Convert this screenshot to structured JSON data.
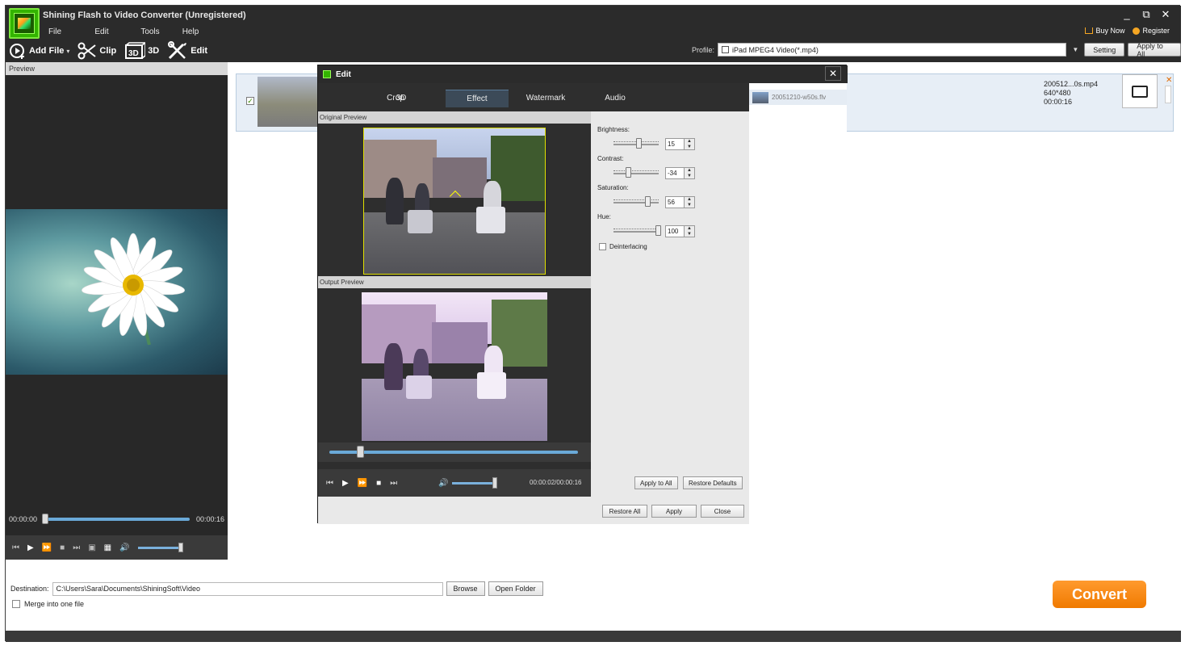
{
  "window": {
    "title": "Shining Flash to Video Converter (Unregistered)",
    "controls": [
      "_",
      "⧉",
      "✕"
    ]
  },
  "menu": [
    "File",
    "Edit",
    "Tools",
    "Help"
  ],
  "header_links": {
    "buy_now": "Buy Now",
    "register": "Register"
  },
  "toolbar": {
    "add_file": "Add File",
    "clip": "Clip",
    "three_d": "3D",
    "edit": "Edit",
    "profile_label": "Profile:",
    "profile_value": "iPad MPEG4 Video(*.mp4)",
    "setting": "Setting",
    "apply_to_all": "Apply to All"
  },
  "preview": {
    "header": "Preview",
    "time_start": "00:00:00",
    "time_end": "00:00:16"
  },
  "file_list": {
    "items": [
      {
        "output_name": "200512...0s.mp4",
        "resolution": "640*480",
        "duration": "00:00:16",
        "checked": true
      }
    ]
  },
  "bottom": {
    "destination_label": "Destination:",
    "destination_path": "C:\\Users\\Sara\\Documents\\ShiningSoft\\Video",
    "browse": "Browse",
    "open_folder": "Open Folder",
    "merge_label": "Merge into one file",
    "convert": "Convert"
  },
  "edit_dialog": {
    "title": "Edit",
    "close_glyph": "✕",
    "tabs": [
      "3D",
      "Crop",
      "Effect",
      "Watermark",
      "Audio"
    ],
    "active_tab": "Effect",
    "original_preview": "Original Preview",
    "output_preview": "Output Preview",
    "time": "00:00:02/00:00:16",
    "settings": {
      "brightness_label": "Brightness:",
      "brightness": "15",
      "contrast_label": "Contrast:",
      "contrast": "-34",
      "saturation_label": "Saturation:",
      "saturation": "56",
      "hue_label": "Hue:",
      "hue": "100",
      "deinterlacing_label": "Deinterlacing"
    },
    "apply_to_all": "Apply to All",
    "restore_defaults": "Restore Defaults",
    "restore_all": "Restore All",
    "apply": "Apply",
    "close": "Close",
    "side_file": "20051210-w50s.flv"
  },
  "colors": {
    "accent_orange": "#f07a00",
    "brand_green": "#33b400",
    "dark_bg": "#2b2b2b"
  }
}
